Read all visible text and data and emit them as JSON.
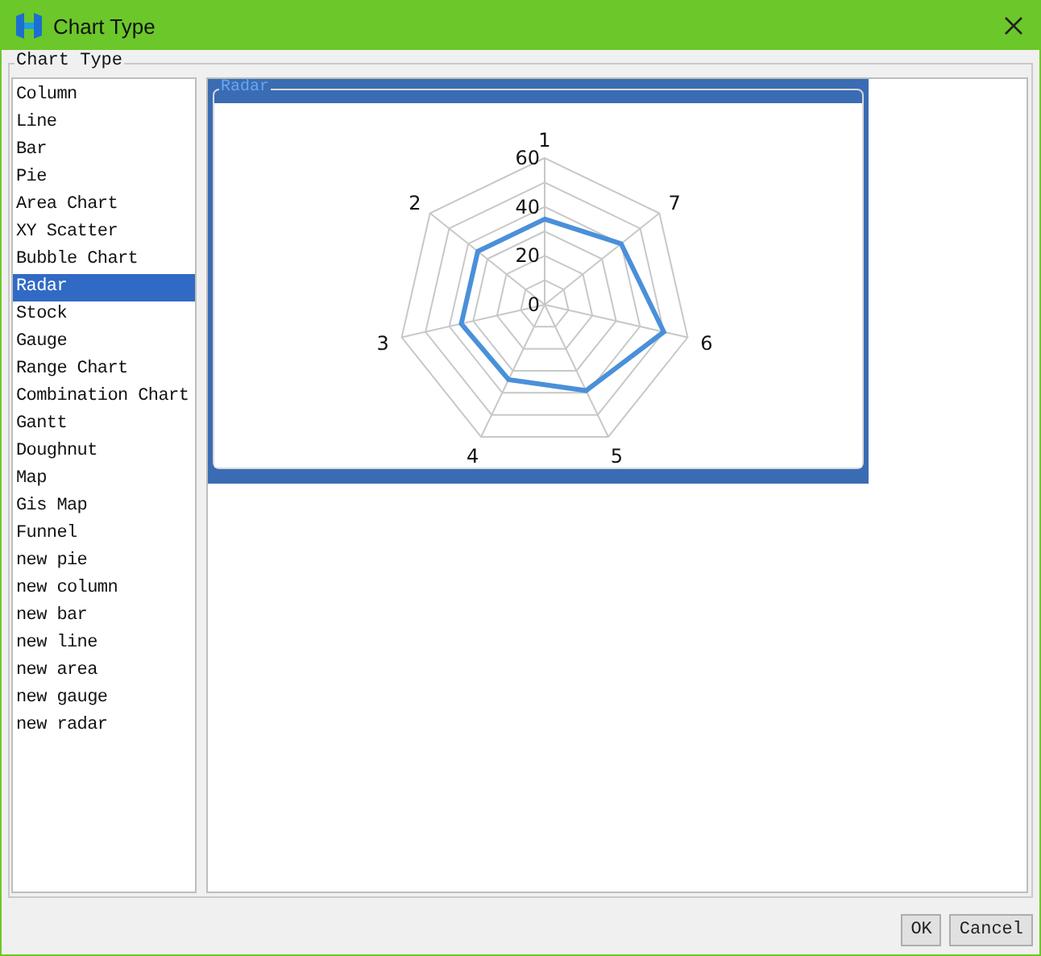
{
  "window": {
    "title": "Chart Type"
  },
  "group_title": "Chart Type",
  "chart_types": [
    {
      "label": "Column",
      "selected": false
    },
    {
      "label": "Line",
      "selected": false
    },
    {
      "label": "Bar",
      "selected": false
    },
    {
      "label": "Pie",
      "selected": false
    },
    {
      "label": "Area Chart",
      "selected": false
    },
    {
      "label": "XY Scatter",
      "selected": false
    },
    {
      "label": "Bubble Chart",
      "selected": false
    },
    {
      "label": "Radar",
      "selected": true
    },
    {
      "label": "Stock",
      "selected": false
    },
    {
      "label": "Gauge",
      "selected": false
    },
    {
      "label": "Range Chart",
      "selected": false
    },
    {
      "label": "Combination Chart",
      "selected": false
    },
    {
      "label": "Gantt",
      "selected": false
    },
    {
      "label": "Doughnut",
      "selected": false
    },
    {
      "label": "Map",
      "selected": false
    },
    {
      "label": "Gis Map",
      "selected": false
    },
    {
      "label": "Funnel",
      "selected": false
    },
    {
      "label": "new pie",
      "selected": false
    },
    {
      "label": "new column",
      "selected": false
    },
    {
      "label": "new bar",
      "selected": false
    },
    {
      "label": "new line",
      "selected": false
    },
    {
      "label": "new area",
      "selected": false
    },
    {
      "label": "new gauge",
      "selected": false
    },
    {
      "label": "new radar",
      "selected": false
    }
  ],
  "preview": {
    "title": "Radar",
    "axis_labels": [
      "1",
      "2",
      "3",
      "4",
      "5",
      "6",
      "7"
    ],
    "tick_labels": [
      "60",
      "40",
      "20",
      "0"
    ]
  },
  "buttons": [
    "OK",
    "Cancel"
  ]
}
